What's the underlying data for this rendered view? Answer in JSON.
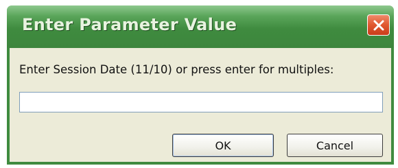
{
  "dialog": {
    "title": "Enter Parameter Value",
    "close_icon": "close-x-icon",
    "prompt": "Enter Session Date (11/10) or press enter for multiples:",
    "input_value": "",
    "ok_label": "OK",
    "cancel_label": "Cancel"
  },
  "colors": {
    "titlebar": "#3f8b3f",
    "client_background": "#ecebd8",
    "close_button": "#e0572f"
  }
}
